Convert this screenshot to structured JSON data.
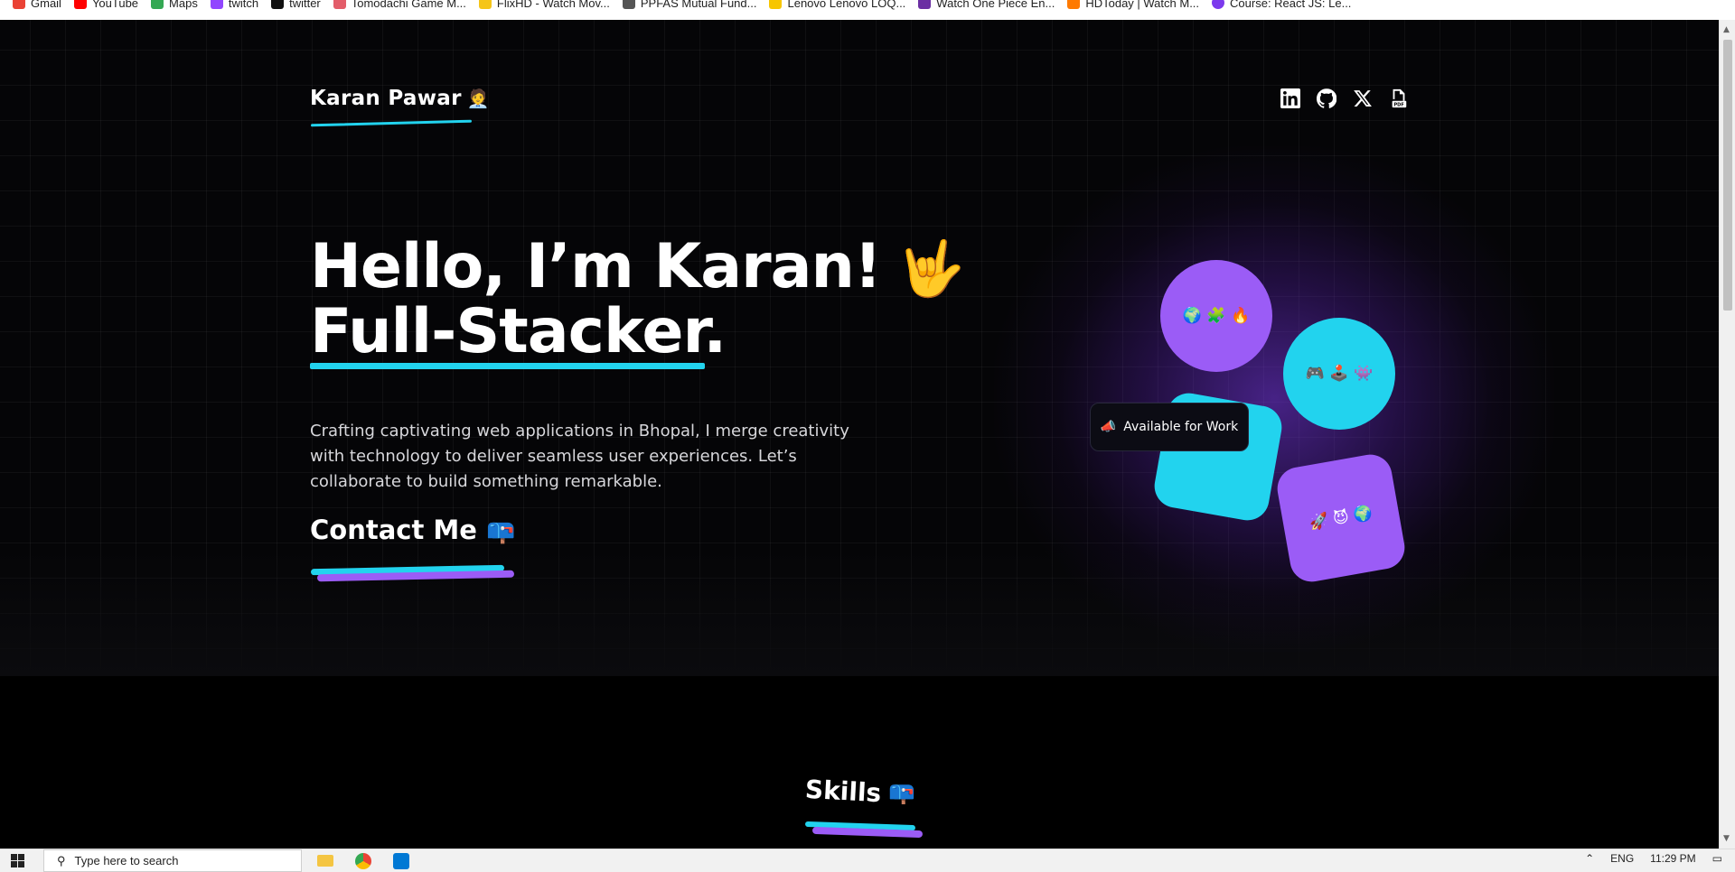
{
  "bookmarks": [
    {
      "label": "Gmail",
      "color": "#ea4335"
    },
    {
      "label": "YouTube",
      "color": "#ff0000"
    },
    {
      "label": "Maps",
      "color": "#34a853"
    },
    {
      "label": "twitch",
      "color": "#9146ff"
    },
    {
      "label": "twitter",
      "color": "#111111"
    },
    {
      "label": "Tomodachi Game M...",
      "color": "#e35d6a"
    },
    {
      "label": "FlixHD - Watch Mov...",
      "color": "#f5c518"
    },
    {
      "label": "PPFAS Mutual Fund...",
      "color": "#555555"
    },
    {
      "label": "Lenovo Lenovo LOQ...",
      "color": "#f7c600"
    },
    {
      "label": "Watch One Piece En...",
      "color": "#6b2fa3"
    },
    {
      "label": "HDToday | Watch M...",
      "color": "#ff7a00"
    },
    {
      "label": "Course: React JS: Le...",
      "color": "#7c3aed"
    }
  ],
  "header": {
    "brand_name": "Karan Pawar",
    "brand_emoji": "🧑‍💼"
  },
  "socials": [
    {
      "name": "linkedin-icon"
    },
    {
      "name": "github-icon"
    },
    {
      "name": "x-icon"
    },
    {
      "name": "pdf-icon"
    }
  ],
  "hero": {
    "greeting": "Hello, I’m Karan!",
    "greeting_emoji": "🤟",
    "role": "Full-Stacker.",
    "description": "Crafting captivating web applications in Bhopal, I merge creativity with technology to deliver seamless user experiences. Let’s collaborate to build something remarkable.",
    "contact_label": "Contact Me",
    "contact_emoji": "📪"
  },
  "visual": {
    "blob1_emojis": "🌍 🧩 🔥",
    "blob2_emojis": "🎮 🕹️ 👾",
    "blob4_emojis": "🚀 😈 🌍",
    "badge_icon": "📣",
    "badge_text": "Available for Work"
  },
  "skills": {
    "title": "Skills",
    "emoji": "📪"
  },
  "taskbar": {
    "search_placeholder": "Type here to search",
    "lang": "ENG",
    "time": "11:29 PM"
  },
  "colors": {
    "accent_cyan": "#22d3ee",
    "accent_purple": "#9b5cf6",
    "background": "#050507"
  }
}
